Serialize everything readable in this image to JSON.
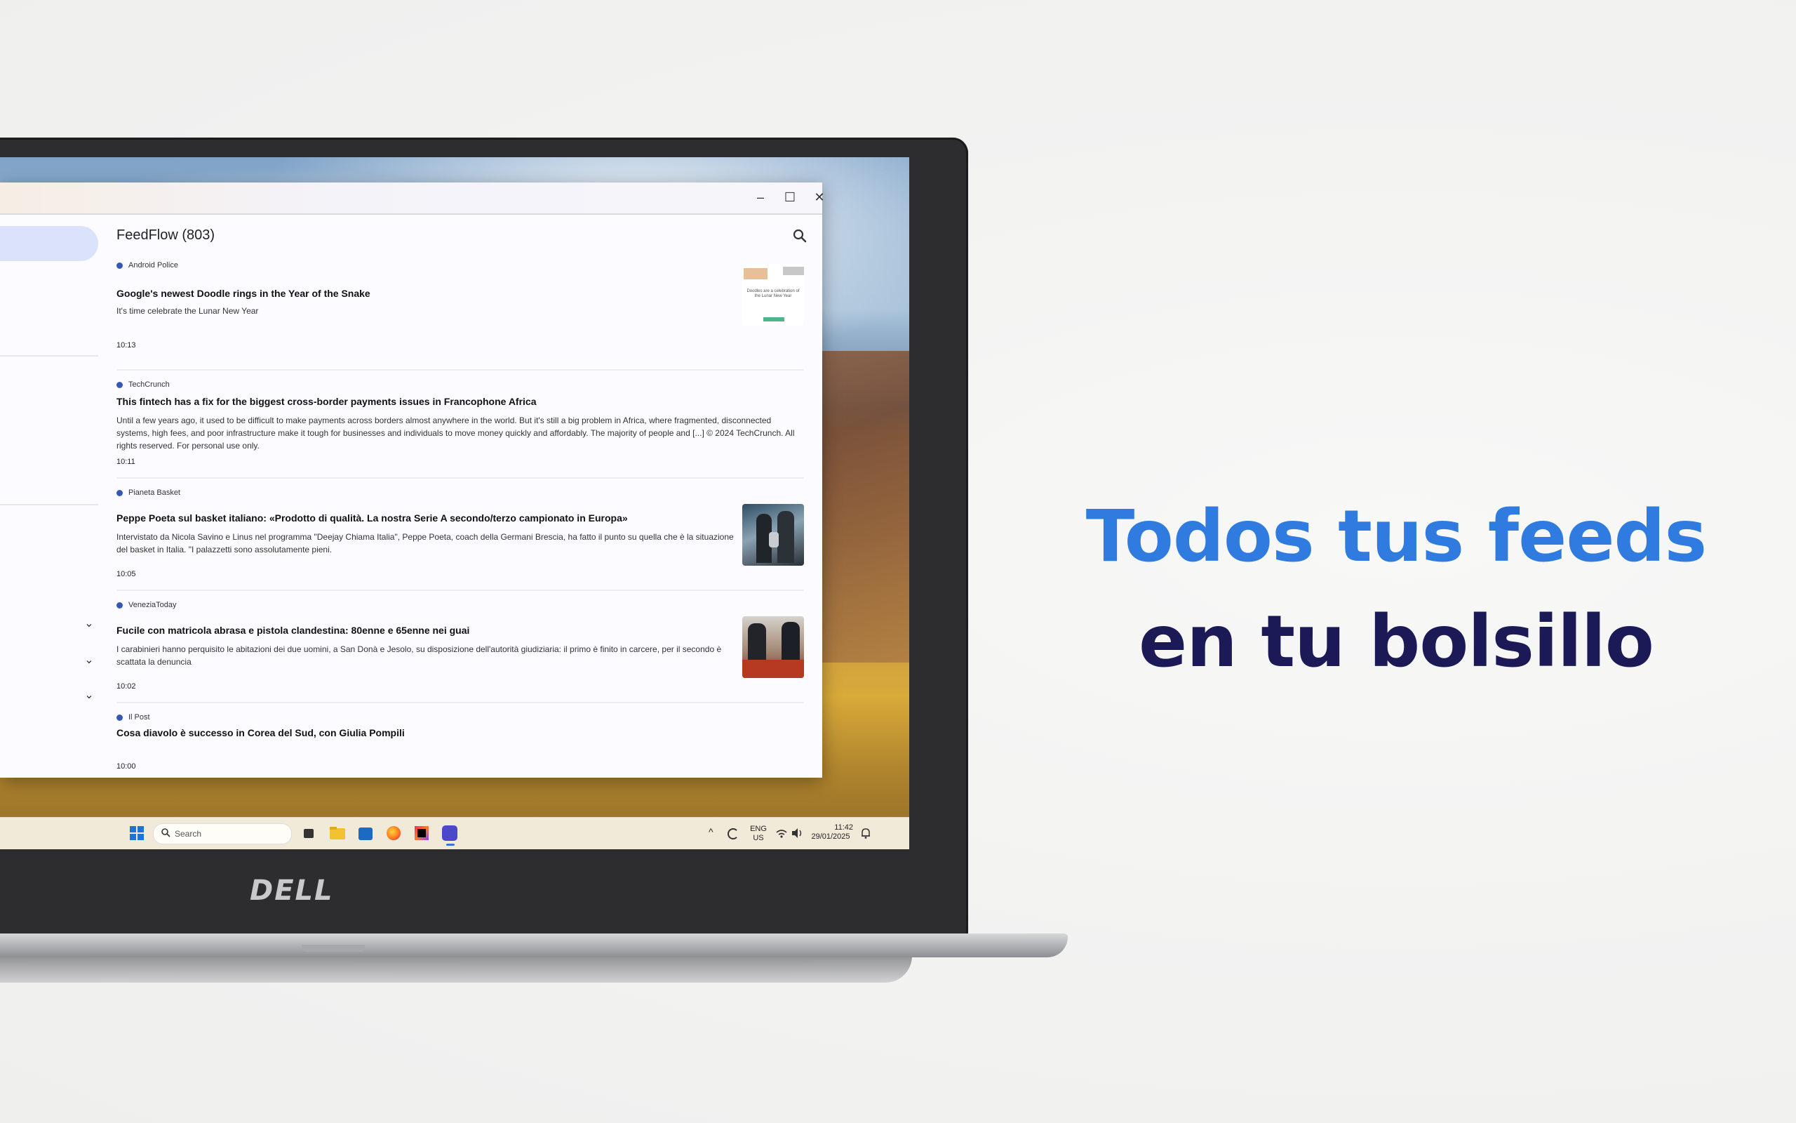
{
  "headline": {
    "line1": "Todos tus feeds",
    "line2": "en tu bolsillo",
    "line1_color": "#2f7be0",
    "line2_color": "#1b1a56"
  },
  "laptop": {
    "brand": "DELL"
  },
  "window": {
    "controls": {
      "minimize": "–",
      "maximize": "☐",
      "close": "✕"
    }
  },
  "app": {
    "title": "FeedFlow (803)",
    "search_icon": "search-icon",
    "accent": "#3558b4"
  },
  "feeds": [
    {
      "source": "Android Police",
      "title": "Google's newest Doodle rings in the Year of the Snake",
      "description": "It's time celebrate the Lunar New Year",
      "time": "10:13",
      "thumbnail_caption": "Doodles are a celebration of the Lunar New Year"
    },
    {
      "source": "TechCrunch",
      "title": "This fintech has a fix for the biggest cross-border payments issues in Francophone Africa",
      "description": "Until a few years ago, it used to be difficult to make payments across borders almost anywhere in the world. But it's still a big problem in Africa, where fragmented, disconnected systems, high fees, and poor infrastructure make it tough for businesses and individuals to move money quickly and affordably. The majority of people and [...] © 2024 TechCrunch. All rights reserved. For personal use only.",
      "time": "10:11"
    },
    {
      "source": "Pianeta Basket",
      "title": "Peppe Poeta sul basket italiano: «Prodotto di qualità. La nostra Serie A secondo/terzo campionato in Europa»",
      "description": "Intervistato da Nicola Savino e Linus nel programma \"Deejay Chiama Italia\", Peppe Poeta, coach della Germani Brescia, ha fatto il punto su quella che è la situazione del basket in Italia. \"I palazzetti sono assolutamente pieni.",
      "time": "10:05"
    },
    {
      "source": "VeneziaToday",
      "title": "Fucile con matricola abrasa e pistola clandestina: 80enne e 65enne nei guai",
      "description": "I carabinieri hanno perquisito le abitazioni dei due uomini, a San Donà e Jesolo, su disposizione dell'autorità giudiziaria: il primo è finito in carcere, per il secondo è scattata la denuncia",
      "time": "10:02"
    },
    {
      "source": "Il Post",
      "title": "Cosa diavolo è successo in Corea del Sud, con Giulia Pompili",
      "description": "",
      "time": "10:00"
    }
  ],
  "taskbar": {
    "search_placeholder": "Search",
    "language_top": "ENG",
    "language_bottom": "US",
    "time": "11:42",
    "date": "29/01/2025",
    "tray_overflow": "^"
  }
}
